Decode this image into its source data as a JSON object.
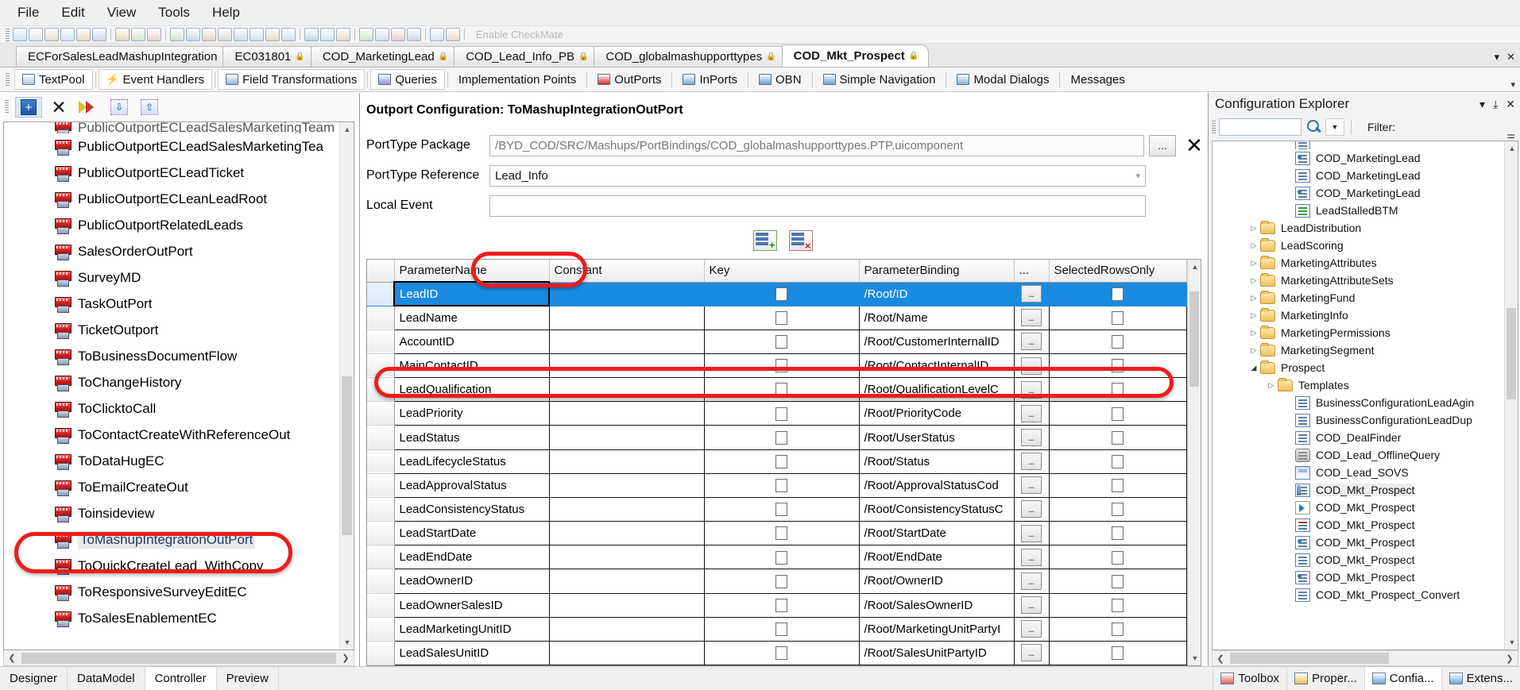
{
  "menubar": {
    "items": [
      "File",
      "Edit",
      "View",
      "Tools",
      "Help"
    ]
  },
  "toolbar": {
    "ghost_label": "Enable CheckMate"
  },
  "document_tabs": {
    "items": [
      {
        "label": "ECForSalesLeadMashupIntegration",
        "locked": false,
        "active": false
      },
      {
        "label": "EC031801",
        "locked": true,
        "active": false
      },
      {
        "label": "COD_MarketingLead",
        "locked": true,
        "active": false
      },
      {
        "label": "COD_Lead_Info_PB",
        "locked": true,
        "active": false
      },
      {
        "label": "COD_globalmashupporttypes",
        "locked": true,
        "active": false
      },
      {
        "label": "COD_Mkt_Prospect",
        "locked": true,
        "active": true
      }
    ],
    "dropdown_icon": "chevron-down-icon",
    "close_icon": "close-icon"
  },
  "view_tabs": {
    "items": [
      {
        "label": "TextPool",
        "icon": "textpool-icon",
        "boxed": true
      },
      {
        "label": "Event Handlers",
        "icon": "lightning-icon",
        "boxed": true
      },
      {
        "label": "Field Transformations",
        "icon": "transform-icon",
        "boxed": true
      },
      {
        "label": "Queries",
        "icon": "queries-icon",
        "boxed": true
      },
      {
        "label": "Implementation Points",
        "icon": "",
        "boxed": false
      },
      {
        "label": "OutPorts",
        "icon": "outport-icon",
        "boxed": false
      },
      {
        "label": "InPorts",
        "icon": "inport-icon",
        "boxed": false
      },
      {
        "label": "OBN",
        "icon": "obn-icon",
        "boxed": false
      },
      {
        "label": "Simple Navigation",
        "icon": "navigation-icon",
        "boxed": false
      },
      {
        "label": "Modal Dialogs",
        "icon": "modal-icon",
        "boxed": false
      },
      {
        "label": "Messages",
        "icon": "",
        "boxed": false
      }
    ],
    "overflow_icon": "chevron-down-icon"
  },
  "left_panel": {
    "toolbar_buttons": [
      {
        "name": "add-button",
        "icon": "plus-icon"
      },
      {
        "name": "delete-button",
        "icon": "x-icon"
      },
      {
        "name": "ab-convert-button",
        "icon": "ab-arrow-icon"
      },
      {
        "name": "move-down-button",
        "icon": "double-chevron-down-icon"
      },
      {
        "name": "move-up-button",
        "icon": "double-chevron-up-icon"
      }
    ],
    "tree_items": [
      {
        "label": "PublicOutportECLeadSalesMarketingTeam",
        "partial": true
      },
      {
        "label": "PublicOutportECLeadSalesMarketingTea",
        "partial": false
      },
      {
        "label": "PublicOutportECLeadTicket",
        "partial": false
      },
      {
        "label": "PublicOutportECLeanLeadRoot",
        "partial": false
      },
      {
        "label": "PublicOutportRelatedLeads",
        "partial": false
      },
      {
        "label": "SalesOrderOutPort",
        "partial": false
      },
      {
        "label": "SurveyMD",
        "partial": false
      },
      {
        "label": "TaskOutPort",
        "partial": false
      },
      {
        "label": "TicketOutport",
        "partial": false
      },
      {
        "label": "ToBusinessDocumentFlow",
        "partial": false
      },
      {
        "label": "ToChangeHistory",
        "partial": false
      },
      {
        "label": "ToClicktoCall",
        "partial": false
      },
      {
        "label": "ToContactCreateWithReferenceOut",
        "partial": false
      },
      {
        "label": "ToDataHugEC",
        "partial": false
      },
      {
        "label": "ToEmailCreateOut",
        "partial": false
      },
      {
        "label": "Toinsideview",
        "partial": false
      },
      {
        "label": "ToMashupIntegrationOutPort",
        "partial": false,
        "selected": true
      },
      {
        "label": "ToQuickCreateLead_WithCopy",
        "partial": false
      },
      {
        "label": "ToResponsiveSurveyEditEC",
        "partial": false
      },
      {
        "label": "ToSalesEnablementEC",
        "partial": false
      }
    ]
  },
  "center_panel": {
    "title": "Outport Configuration: ToMashupIntegrationOutPort",
    "fields": [
      {
        "label": "PortType Package",
        "value": "/BYD_COD/SRC/Mashups/PortBindings/COD_globalmashupporttypes.PTP.uicomponent",
        "has_browse": true,
        "browse_label": "...",
        "has_clear": true,
        "clear_label": "✕"
      },
      {
        "label": "PortType Reference",
        "value": "Lead_Info",
        "has_dropdown": true,
        "highlighted": true
      },
      {
        "label": "Local Event",
        "value": ""
      }
    ],
    "grid_tools": [
      {
        "name": "add-row-button",
        "icon": "add-row-icon"
      },
      {
        "name": "delete-row-button",
        "icon": "delete-row-icon"
      }
    ],
    "table": {
      "columns": [
        "ParameterName",
        "Constant",
        "Key",
        "ParameterBinding",
        "...",
        "SelectedRowsOnly"
      ],
      "rows": [
        {
          "ParameterName": "LeadID",
          "Constant": "",
          "Key": false,
          "ParameterBinding": "/Root/ID",
          "more": "...",
          "SelectedRowsOnly": false,
          "selected": true
        },
        {
          "ParameterName": "LeadName",
          "Constant": "",
          "Key": false,
          "ParameterBinding": "/Root/Name",
          "more": "...",
          "SelectedRowsOnly": false
        },
        {
          "ParameterName": "AccountID",
          "Constant": "",
          "Key": false,
          "ParameterBinding": "/Root/CustomerInternalID",
          "more": "...",
          "SelectedRowsOnly": false
        },
        {
          "ParameterName": "MainContactID",
          "Constant": "",
          "Key": false,
          "ParameterBinding": "/Root/ContactInternalID",
          "more": "...",
          "SelectedRowsOnly": false
        },
        {
          "ParameterName": "LeadQualification",
          "Constant": "",
          "Key": false,
          "ParameterBinding": "/Root/QualificationLevelC",
          "more": "...",
          "SelectedRowsOnly": false
        },
        {
          "ParameterName": "LeadPriority",
          "Constant": "",
          "Key": false,
          "ParameterBinding": "/Root/PriorityCode",
          "more": "...",
          "SelectedRowsOnly": false
        },
        {
          "ParameterName": "LeadStatus",
          "Constant": "",
          "Key": false,
          "ParameterBinding": "/Root/UserStatus",
          "more": "...",
          "SelectedRowsOnly": false
        },
        {
          "ParameterName": "LeadLifecycleStatus",
          "Constant": "",
          "Key": false,
          "ParameterBinding": "/Root/Status",
          "more": "...",
          "SelectedRowsOnly": false
        },
        {
          "ParameterName": "LeadApprovalStatus",
          "Constant": "",
          "Key": false,
          "ParameterBinding": "/Root/ApprovalStatusCod",
          "more": "...",
          "SelectedRowsOnly": false
        },
        {
          "ParameterName": "LeadConsistencyStatus",
          "Constant": "",
          "Key": false,
          "ParameterBinding": "/Root/ConsistencyStatusC",
          "more": "...",
          "SelectedRowsOnly": false
        },
        {
          "ParameterName": "LeadStartDate",
          "Constant": "",
          "Key": false,
          "ParameterBinding": "/Root/StartDate",
          "more": "...",
          "SelectedRowsOnly": false
        },
        {
          "ParameterName": "LeadEndDate",
          "Constant": "",
          "Key": false,
          "ParameterBinding": "/Root/EndDate",
          "more": "...",
          "SelectedRowsOnly": false
        },
        {
          "ParameterName": "LeadOwnerID",
          "Constant": "",
          "Key": false,
          "ParameterBinding": "/Root/OwnerID",
          "more": "...",
          "SelectedRowsOnly": false
        },
        {
          "ParameterName": "LeadOwnerSalesID",
          "Constant": "",
          "Key": false,
          "ParameterBinding": "/Root/SalesOwnerID",
          "more": "...",
          "SelectedRowsOnly": false
        },
        {
          "ParameterName": "LeadMarketingUnitID",
          "Constant": "",
          "Key": false,
          "ParameterBinding": "/Root/MarketingUnitPartyI",
          "more": "...",
          "SelectedRowsOnly": false
        },
        {
          "ParameterName": "LeadSalesUnitID",
          "Constant": "",
          "Key": false,
          "ParameterBinding": "/Root/SalesUnitPartyID",
          "more": "...",
          "SelectedRowsOnly": false
        }
      ]
    }
  },
  "right_panel": {
    "title": "Configuration Explorer",
    "header_buttons": [
      {
        "name": "panel-menu-button",
        "glyph": "▾"
      },
      {
        "name": "pin-button",
        "glyph": "⤓"
      },
      {
        "name": "close-panel-button",
        "glyph": "✕"
      }
    ],
    "search_placeholder": "",
    "search_value": "",
    "search_icon": "search-icon",
    "dropdown_icon": "chevron-down-icon",
    "filter_label": "Filter:",
    "filter_more_icon": "filter-expand-icon",
    "tree_items": [
      {
        "label": "",
        "indent": 4,
        "icon": "form-icon",
        "partial": true
      },
      {
        "label": "COD_MarketingLead",
        "indent": 4,
        "icon": "report-icon"
      },
      {
        "label": "COD_MarketingLead",
        "indent": 4,
        "icon": "quickview-icon"
      },
      {
        "label": "COD_MarketingLead",
        "indent": 4,
        "icon": "factsheet-icon"
      },
      {
        "label": "LeadStalledBTM",
        "indent": 4,
        "icon": "btm-icon"
      },
      {
        "label": "LeadDistribution",
        "indent": 2,
        "icon": "folder-icon",
        "arrow": "collapsed"
      },
      {
        "label": "LeadScoring",
        "indent": 2,
        "icon": "folder-icon",
        "arrow": "collapsed"
      },
      {
        "label": "MarketingAttributes",
        "indent": 2,
        "icon": "folder-icon",
        "arrow": "collapsed"
      },
      {
        "label": "MarketingAttributeSets",
        "indent": 2,
        "icon": "folder-icon",
        "arrow": "collapsed"
      },
      {
        "label": "MarketingFund",
        "indent": 2,
        "icon": "folder-icon",
        "arrow": "collapsed"
      },
      {
        "label": "MarketingInfo",
        "indent": 2,
        "icon": "folder-icon",
        "arrow": "collapsed"
      },
      {
        "label": "MarketingPermissions",
        "indent": 2,
        "icon": "folder-icon",
        "arrow": "collapsed"
      },
      {
        "label": "MarketingSegment",
        "indent": 2,
        "icon": "folder-icon",
        "arrow": "collapsed"
      },
      {
        "label": "Prospect",
        "indent": 2,
        "icon": "folder-icon",
        "arrow": "expanded"
      },
      {
        "label": "Templates",
        "indent": 3,
        "icon": "folder-icon",
        "arrow": "collapsed"
      },
      {
        "label": "BusinessConfigurationLeadAgin",
        "indent": 4,
        "icon": "document-icon"
      },
      {
        "label": "BusinessConfigurationLeadDup",
        "indent": 4,
        "icon": "document-icon"
      },
      {
        "label": "COD_DealFinder",
        "indent": 4,
        "icon": "document-icon"
      },
      {
        "label": "COD_Lead_OfflineQuery",
        "indent": 4,
        "icon": "database-icon"
      },
      {
        "label": "COD_Lead_SOVS",
        "indent": 4,
        "icon": "window-icon"
      },
      {
        "label": "COD_Mkt_Prospect",
        "indent": 4,
        "icon": "uicomponent-icon",
        "selected": true
      },
      {
        "label": "COD_Mkt_Prospect",
        "indent": 4,
        "icon": "porttype-icon"
      },
      {
        "label": "COD_Mkt_Prospect",
        "indent": 4,
        "icon": "layout-icon"
      },
      {
        "label": "COD_Mkt_Prospect",
        "indent": 4,
        "icon": "report-icon"
      },
      {
        "label": "COD_Mkt_Prospect",
        "indent": 4,
        "icon": "quickview-icon"
      },
      {
        "label": "COD_Mkt_Prospect",
        "indent": 4,
        "icon": "factsheet-icon"
      },
      {
        "label": "COD_Mkt_Prospect_Convert",
        "indent": 4,
        "icon": "document-icon"
      }
    ]
  },
  "bottom_bar": {
    "left_tabs": [
      {
        "label": "Designer",
        "active": false
      },
      {
        "label": "DataModel",
        "active": false
      },
      {
        "label": "Controller",
        "active": true
      },
      {
        "label": "Preview",
        "active": false
      }
    ],
    "right_tabs": [
      {
        "label": "Toolbox",
        "icon": "toolbox-icon",
        "active": false
      },
      {
        "label": "Proper...",
        "icon": "properties-icon",
        "active": false
      },
      {
        "label": "Confia...",
        "icon": "config-icon",
        "active": true
      },
      {
        "label": "Extens...",
        "icon": "extensions-icon",
        "active": false
      }
    ]
  },
  "highlights": {
    "color": "#ee1c1c",
    "regions": [
      "sidebar-tomashupintegrationoutport",
      "porttype-reference-lead-info",
      "table-row-leadid"
    ]
  }
}
